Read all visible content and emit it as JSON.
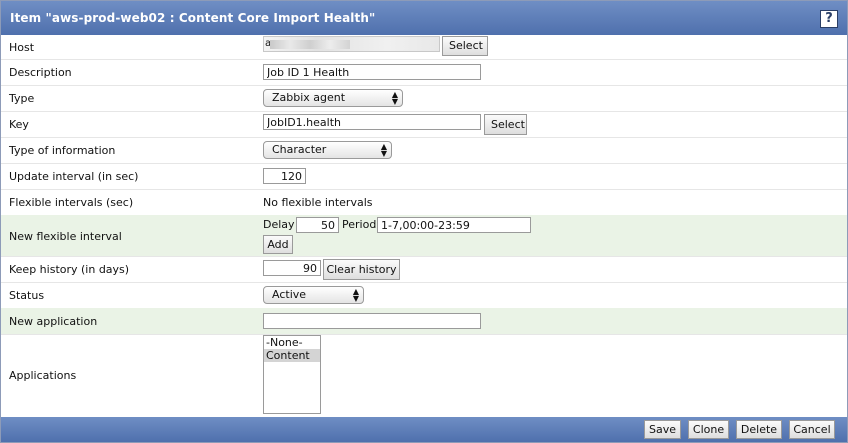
{
  "window": {
    "title": "Item \"aws-prod-web02 : Content Core Import Health\"",
    "help_label": "?"
  },
  "host": {
    "label": "Host",
    "value_prefix": "a",
    "select_label": "Select"
  },
  "description": {
    "label": "Description",
    "value": "Job ID 1 Health"
  },
  "type": {
    "label": "Type",
    "value": "Zabbix agent"
  },
  "key": {
    "label": "Key",
    "value": "JobID1.health",
    "select_label": "Select"
  },
  "type_of_information": {
    "label": "Type of information",
    "value": "Character"
  },
  "update_interval": {
    "label": "Update interval (in sec)",
    "value": "120"
  },
  "flexible_intervals": {
    "label": "Flexible intervals (sec)",
    "value": "No flexible intervals"
  },
  "new_flexible_interval": {
    "label": "New flexible interval",
    "delay_label": "Delay",
    "delay_value": "50",
    "period_label": "Period",
    "period_value": "1-7,00:00-23:59",
    "add_label": "Add"
  },
  "keep_history": {
    "label": "Keep history (in days)",
    "value": "90",
    "clear_label": "Clear history"
  },
  "status": {
    "label": "Status",
    "value": "Active"
  },
  "new_application": {
    "label": "New application",
    "value": ""
  },
  "applications": {
    "label": "Applications",
    "options": [
      "-None-",
      "Content"
    ],
    "selected_index": 1
  },
  "footer": {
    "save": "Save",
    "clone": "Clone",
    "delete": "Delete",
    "cancel": "Cancel"
  },
  "icons": {
    "help": "question-mark-icon",
    "dropdown": "updown-arrows-icon"
  },
  "colors": {
    "titlebar": "#5576b4",
    "row_highlight": "#eaf3e6",
    "selected_option": "#d4d4d4"
  }
}
